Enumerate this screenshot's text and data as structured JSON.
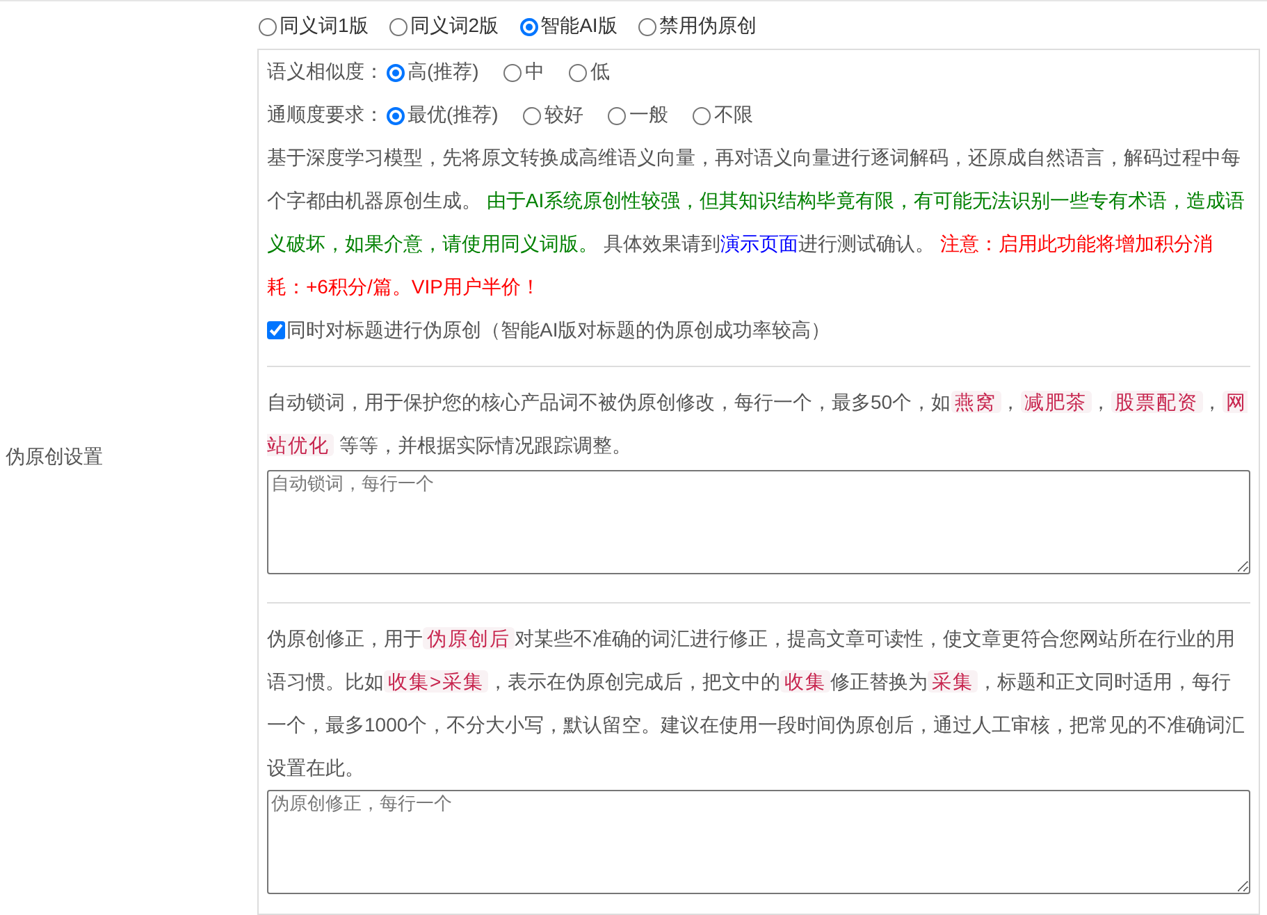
{
  "section_label": "伪原创设置",
  "modes": [
    {
      "label": "同义词1版",
      "selected": false
    },
    {
      "label": "同义词2版",
      "selected": false
    },
    {
      "label": "智能AI版",
      "selected": true
    },
    {
      "label": "禁用伪原创",
      "selected": false
    }
  ],
  "option_groups": [
    {
      "label": "语义相似度：",
      "options": [
        {
          "label": "高(推荐)",
          "selected": true
        },
        {
          "label": "中",
          "selected": false
        },
        {
          "label": "低",
          "selected": false
        }
      ]
    },
    {
      "label": "通顺度要求：",
      "options": [
        {
          "label": "最优(推荐)",
          "selected": true
        },
        {
          "label": "较好",
          "selected": false
        },
        {
          "label": "一般",
          "selected": false
        },
        {
          "label": "不限",
          "selected": false
        }
      ]
    }
  ],
  "ai_description": [
    {
      "kind": "plain",
      "text": "基于深度学习模型，先将原文转换成高维语义向量，再对语义向量进行逐词解码，还原成自然语言，解码过程中每个字都由机器原创生成。 "
    },
    {
      "kind": "note",
      "text": "由于AI系统原创性较强，但其知识结构毕竟有限，有可能无法识别一些专有术语，造成语义破坏，如果介意，请使用同义词版。"
    },
    {
      "kind": "plain",
      "text": " 具体效果请到"
    },
    {
      "kind": "link",
      "text": "演示页面"
    },
    {
      "kind": "plain",
      "text": "进行测试确认。 "
    },
    {
      "kind": "warning",
      "text": "注意：启用此功能将增加积分消耗：+6积分/篇。VIP用户半价！"
    }
  ],
  "title_option": {
    "label": "同时对标题进行伪原创（智能AI版对标题的伪原创成功率较高）",
    "checked": true
  },
  "lock_words": {
    "description": [
      {
        "kind": "plain",
        "text": "自动锁词，用于保护您的核心产品词不被伪原创修改，每行一个，最多50个，如"
      },
      {
        "kind": "tag",
        "text": "燕窝"
      },
      {
        "kind": "plain",
        "text": "，"
      },
      {
        "kind": "tag",
        "text": "减肥茶"
      },
      {
        "kind": "plain",
        "text": "，"
      },
      {
        "kind": "tag",
        "text": "股票配资"
      },
      {
        "kind": "plain",
        "text": "，"
      },
      {
        "kind": "tag",
        "text": "网站优化"
      },
      {
        "kind": "plain",
        "text": " 等等，并根据实际情况跟踪调整。"
      }
    ],
    "placeholder": "自动锁词，每行一个"
  },
  "corrections": {
    "description": [
      {
        "kind": "plain",
        "text": "伪原创修正，用于"
      },
      {
        "kind": "tag",
        "text": "伪原创后"
      },
      {
        "kind": "plain",
        "text": "对某些不准确的词汇进行修正，提高文章可读性，使文章更符合您网站所在行业的用语习惯。比如"
      },
      {
        "kind": "tag",
        "text": "收集>采集"
      },
      {
        "kind": "plain",
        "text": "，表示在伪原创完成后，把文中的"
      },
      {
        "kind": "tag",
        "text": "收集"
      },
      {
        "kind": "plain",
        "text": "修正替换为"
      },
      {
        "kind": "tag",
        "text": "采集"
      },
      {
        "kind": "plain",
        "text": "，标题和正文同时适用，每行一个，最多1000个，不分大小写，默认留空。建议在使用一段时间伪原创后，通过人工审核，把常见的不准确词汇设置在此。"
      }
    ],
    "placeholder": "伪原创修正，每行一个"
  }
}
